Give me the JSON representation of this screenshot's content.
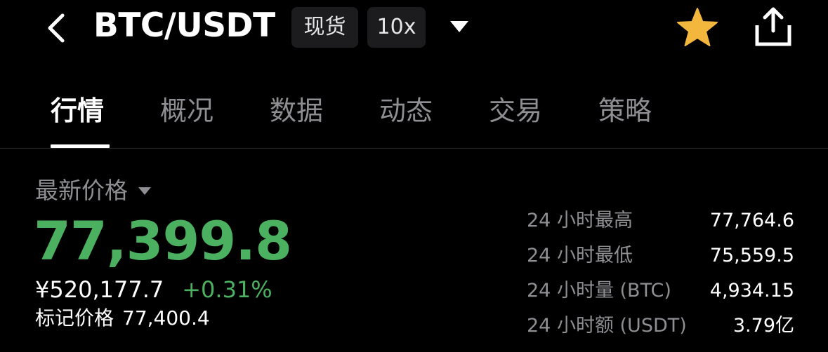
{
  "header": {
    "pair": "BTC/USDT",
    "market_tag": "现货",
    "leverage_tag": "10x",
    "icons": {
      "back": "chevron-left-icon",
      "dropdown": "caret-down-icon",
      "favorite": "star-icon",
      "share": "share-icon"
    },
    "colors": {
      "favorite_star": "#f4b73e"
    }
  },
  "tabs": [
    {
      "label": "行情",
      "active": true
    },
    {
      "label": "概况",
      "active": false
    },
    {
      "label": "数据",
      "active": false
    },
    {
      "label": "动态",
      "active": false
    },
    {
      "label": "交易",
      "active": false
    },
    {
      "label": "策略",
      "active": false
    }
  ],
  "price": {
    "label": "最新价格",
    "last": "77,399.8",
    "cny": "¥520,177.7",
    "change_pct": "+0.31%",
    "mark_label": "标记价格",
    "mark_value": "77,400.4"
  },
  "stats": [
    {
      "label": "24 小时最高",
      "value": "77,764.6"
    },
    {
      "label": "24 小时最低",
      "value": "75,559.5"
    },
    {
      "label": "24 小时量 (BTC)",
      "value": "4,934.15"
    },
    {
      "label": "24 小时额 (USDT)",
      "value": "3.79亿"
    }
  ],
  "colors": {
    "background": "#000000",
    "up": "#4cb061",
    "muted": "#8e8e93",
    "tag_bg": "#1c1c1e"
  }
}
